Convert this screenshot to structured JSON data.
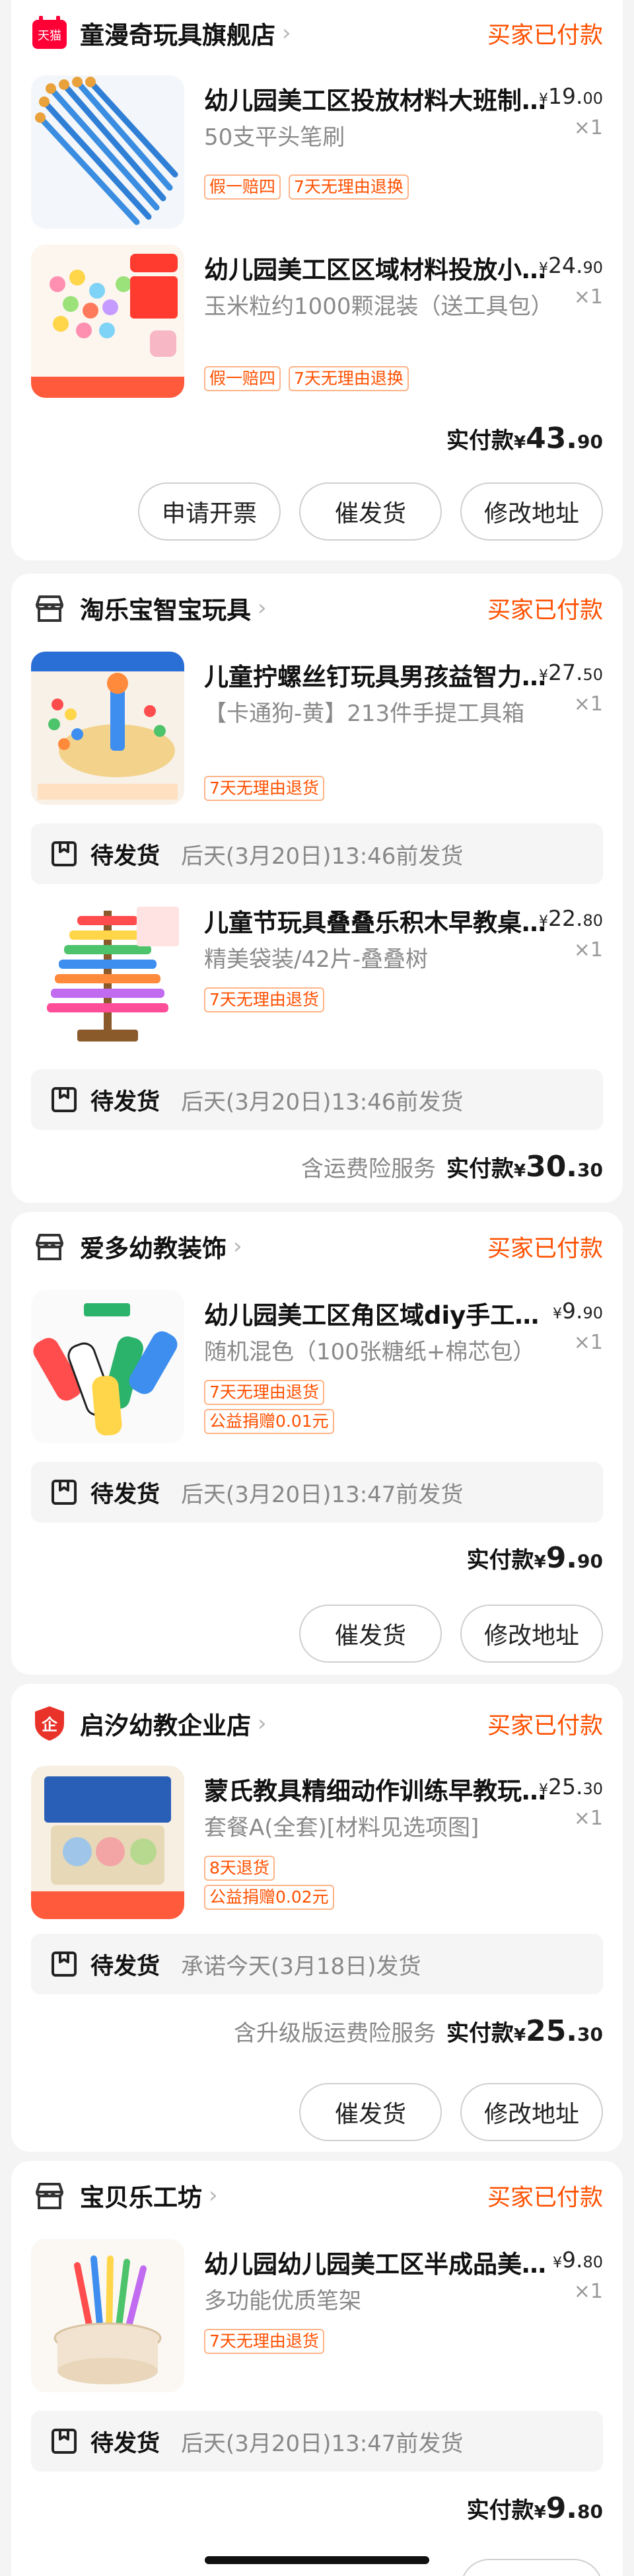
{
  "stores": [
    {
      "name": "童漫奇玩具旗舰店",
      "logo": "tmall-icon",
      "logo_text": "天猫",
      "status": "买家已付款",
      "items": [
        {
          "title": "幼儿园美工区投放材料大班制…",
          "price_int": "19.",
          "price_dec": "00",
          "qty": "×1",
          "spec": "50支平头笔刷",
          "tags": [
            "假一赔四",
            "7天无理由退换"
          ]
        },
        {
          "title": "幼儿园美工区区域材料投放小…",
          "price_int": "24.",
          "price_dec": "90",
          "qty": "×1",
          "spec": "玉米粒约1000颗混装（送工具包）",
          "tags": [
            "假一赔四",
            "7天无理由退换"
          ]
        }
      ],
      "total_label": "实付款",
      "total_int": "43.",
      "total_dec": "90",
      "buttons": [
        "申请开票",
        "催发货",
        "修改地址"
      ]
    },
    {
      "name": "淘乐宝智宝玩具",
      "logo": "store-icon",
      "status": "买家已付款",
      "items": [
        {
          "title": "儿童拧螺丝钉玩具男孩益智力…",
          "price_int": "27.",
          "price_dec": "50",
          "qty": "×1",
          "spec": "【卡通狗-黄】213件手提工具箱",
          "tags": [
            "7天无理由退货"
          ],
          "ship_status": "待发货",
          "ship_time": "后天(3月20日)13:46前发货"
        },
        {
          "title": "儿童节玩具叠叠乐积木早教桌…",
          "price_int": "22.",
          "price_dec": "80",
          "qty": "×1",
          "spec": "精美袋装/42片-叠叠树",
          "tags": [
            "7天无理由退货"
          ],
          "ship_status": "待发货",
          "ship_time": "后天(3月20日)13:46前发货"
        }
      ],
      "total_note": "含运费险服务",
      "total_label": "实付款",
      "total_int": "30.",
      "total_dec": "30"
    },
    {
      "name": "爱多幼教装饰",
      "logo": "store-icon",
      "status": "买家已付款",
      "items": [
        {
          "title": "幼儿园美工区角区域diy手工仿…",
          "price_int": "9.",
          "price_dec": "90",
          "qty": "×1",
          "spec": "随机混色（100张糖纸+棉芯包）",
          "tags": [
            "7天无理由退货",
            "公益捐赠0.01元"
          ],
          "ship_status": "待发货",
          "ship_time": "后天(3月20日)13:47前发货"
        }
      ],
      "total_label": "实付款",
      "total_int": "9.",
      "total_dec": "90",
      "buttons": [
        "催发货",
        "修改地址"
      ]
    },
    {
      "name": "启汐幼教企业店",
      "logo": "enterprise-icon",
      "logo_text": "企",
      "status": "买家已付款",
      "items": [
        {
          "title": "蒙氏教具精细动作训练早教玩…",
          "price_int": "25.",
          "price_dec": "30",
          "qty": "×1",
          "spec": "套餐A(全套)[材料见选项图]",
          "tags": [
            "8天退货",
            "公益捐赠0.02元"
          ],
          "ship_status": "待发货",
          "ship_time": "承诺今天(3月18日)发货"
        }
      ],
      "total_note": "含升级版运费险服务",
      "total_label": "实付款",
      "total_int": "25.",
      "total_dec": "30",
      "buttons": [
        "催发货",
        "修改地址"
      ]
    },
    {
      "name": "宝贝乐工坊",
      "logo": "store-icon",
      "status": "买家已付款",
      "items": [
        {
          "title": "幼儿园幼儿园美工区半成品美…",
          "price_int": "9.",
          "price_dec": "80",
          "qty": "×1",
          "spec": "多功能优质笔架",
          "tags": [
            "7天无理由退货"
          ],
          "ship_status": "待发货",
          "ship_time": "后天(3月20日)13:47前发货"
        }
      ],
      "total_label": "实付款",
      "total_int": "9.",
      "total_dec": "80"
    }
  ],
  "currency": "¥",
  "colors": {
    "accent": "#ff5000",
    "tag_border": "#ffb488",
    "page_bg": "#f4f4f4"
  },
  "icons": {
    "chevron": "›"
  }
}
